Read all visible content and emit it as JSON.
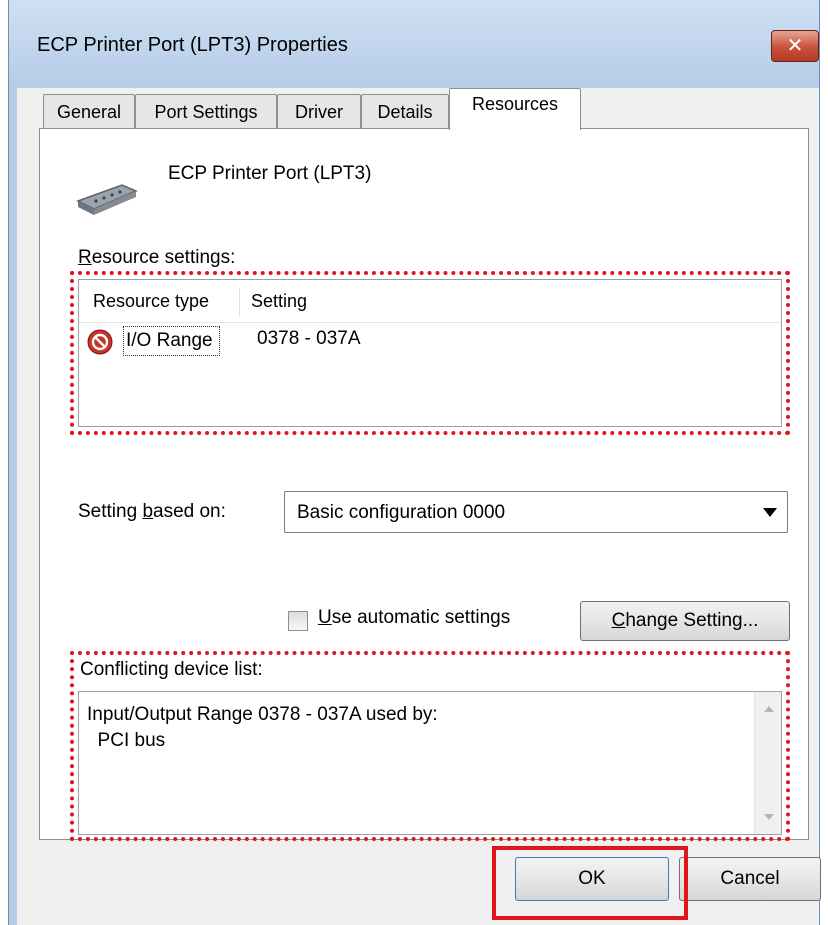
{
  "window": {
    "title": "ECP Printer Port (LPT3) Properties",
    "close_glyph": "✕"
  },
  "tabs": [
    {
      "label": "General"
    },
    {
      "label": "Port Settings"
    },
    {
      "label": "Driver"
    },
    {
      "label": "Details"
    },
    {
      "label": "Resources",
      "active": true
    }
  ],
  "device": {
    "name": "ECP Printer Port (LPT3)",
    "icon": "printer-port-icon"
  },
  "resource_settings": {
    "label_accel": "R",
    "label_rest": "esource settings:",
    "columns": [
      "Resource type",
      "Setting"
    ],
    "rows": [
      {
        "type": "I/O Range",
        "setting": "0378 - 037A",
        "icon": "conflict-icon",
        "status": "conflict"
      }
    ]
  },
  "setting_based_on": {
    "label_pre": "Setting ",
    "label_accel": "b",
    "label_post": "ased on:",
    "value": "Basic configuration 0000"
  },
  "auto_settings": {
    "accel": "U",
    "rest": "se automatic settings",
    "checked": false
  },
  "change_setting_button": {
    "accel": "C",
    "rest": "hange Setting..."
  },
  "conflict": {
    "label": "Conflicting device list:",
    "lines": [
      "Input/Output Range 0378 - 037A used by:",
      "  PCI bus"
    ]
  },
  "buttons": {
    "ok": "OK",
    "cancel": "Cancel"
  },
  "colors": {
    "highlight": "#e0141c",
    "title_bar": "#c3d8ef",
    "dialog_bg": "#f0f0f0"
  }
}
